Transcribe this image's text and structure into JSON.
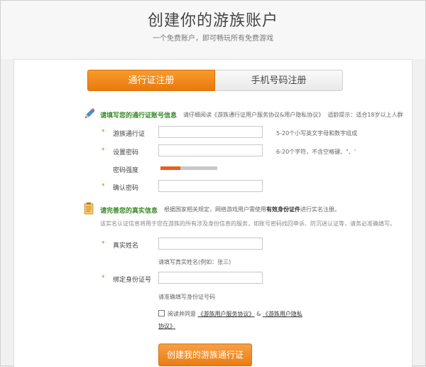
{
  "header": {
    "title": "创建你的游族账户",
    "subtitle": "一个免费账户，即可畅玩所有免费游戏"
  },
  "tabs": [
    {
      "label": "通行证注册",
      "active": true
    },
    {
      "label": "手机号码注册",
      "active": false
    }
  ],
  "account_section": {
    "title": "请填写您的通行证账号信息",
    "notice_prefix": "请仔细阅读",
    "notice_link": "《游族通行证用户服务协议&用户隐私协议》",
    "notice_suffix": "适龄提示：适合18岁以上人群"
  },
  "fields": {
    "username": {
      "required_mark": "*",
      "label": "游族通行证",
      "value": "",
      "hint": "5-20个小写英文字母和数字组成"
    },
    "password": {
      "required_mark": "*",
      "label": "设置密码",
      "value": "",
      "hint": "6-20个字符，不含空格键、\"、'"
    },
    "strength": {
      "label": "密码强度",
      "level": 0.35
    },
    "confirm": {
      "required_mark": "*",
      "label": "确认密码",
      "value": ""
    }
  },
  "identity_section": {
    "title": "请完善您的真实信息",
    "notice_prefix": "根据国家相关规定，网络游戏用户需使用",
    "notice_bold": "有效身份证件",
    "notice_suffix": "进行实名注册。",
    "description": "该实名认证信息将用于您在游族的所有涉及身份信息的服务，如账号密码找回申诉、防沉迷认证等，请务必准确填写。"
  },
  "identity_fields": {
    "realname": {
      "required_mark": "*",
      "label": "真实姓名",
      "value": "",
      "hint": "请填写真实姓名(例如：张三)"
    },
    "idcard": {
      "required_mark": "*",
      "label": "绑定身份证号",
      "value": "",
      "hint": "请准确填写身份证号码"
    }
  },
  "agreement": {
    "prefix": "阅读并同意",
    "link1": "《游族用户服务协议》",
    "amp": "&",
    "link2a": "《游族用户隐私",
    "link2b": "协议》",
    "checked": false
  },
  "submit": {
    "label": "创建我的游族通行证"
  },
  "colors": {
    "accent": "#ea7a0d",
    "section_title": "#3a8a2a",
    "strength": "#e8601a"
  },
  "icons": {
    "account": "pencil-icon",
    "identity": "notepad-icon"
  }
}
